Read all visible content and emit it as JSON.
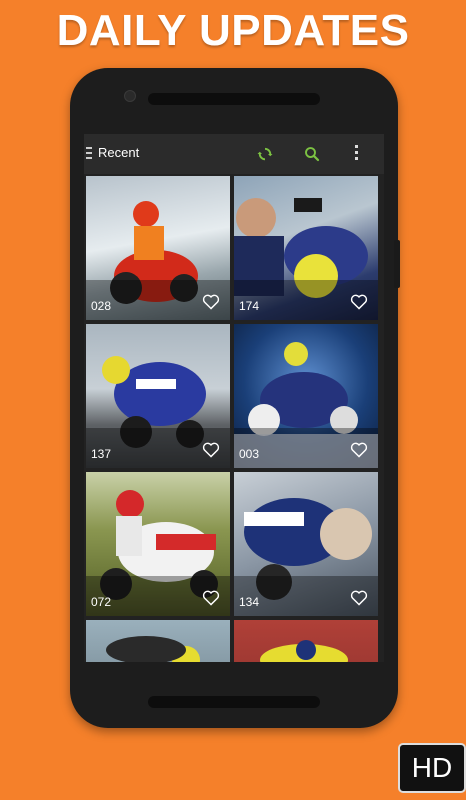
{
  "headline": "DAILY UPDATES",
  "appbar": {
    "title": "Recent",
    "accent_color": "#7cc242"
  },
  "wallpapers": [
    {
      "count": "028"
    },
    {
      "count": "174"
    },
    {
      "count": "137"
    },
    {
      "count": "003"
    },
    {
      "count": "072"
    },
    {
      "count": "134"
    },
    {
      "count": ""
    },
    {
      "count": ""
    }
  ],
  "badge": {
    "label": "HD"
  },
  "colors": {
    "background": "#f5802a",
    "phone": "#1d1d1d",
    "appbar": "#2b2b2b"
  }
}
